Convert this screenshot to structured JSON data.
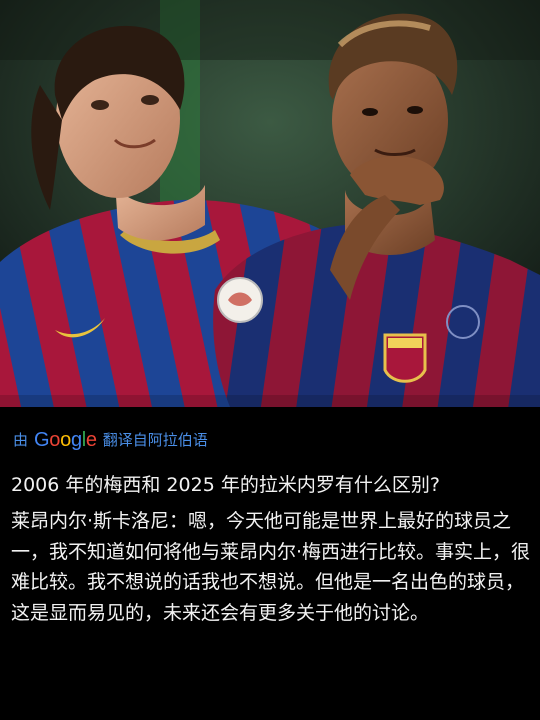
{
  "translation": {
    "prefix": "由",
    "brand_name": "Google",
    "suffix": "翻译自阿拉伯语",
    "link_color": "#4a8ee6"
  },
  "post": {
    "question": "2006 年的梅西和 2025 年的拉米内罗有什么区别?",
    "answer": "莱昂内尔·斯卡洛尼：嗯，今天他可能是世界上最好的球员之一，我不知道如何将他与莱昂内尔·梅西进行比较。事实上，很难比较。我不想说的话我也不想说。但他是一名出色的球员，这是显而易见的，未来还会有更多关于他的讨论。"
  },
  "colors": {
    "background": "#000000",
    "text": "#f2f2f2",
    "kit_blue": "#1c3f8f",
    "kit_red": "#a5153a"
  }
}
